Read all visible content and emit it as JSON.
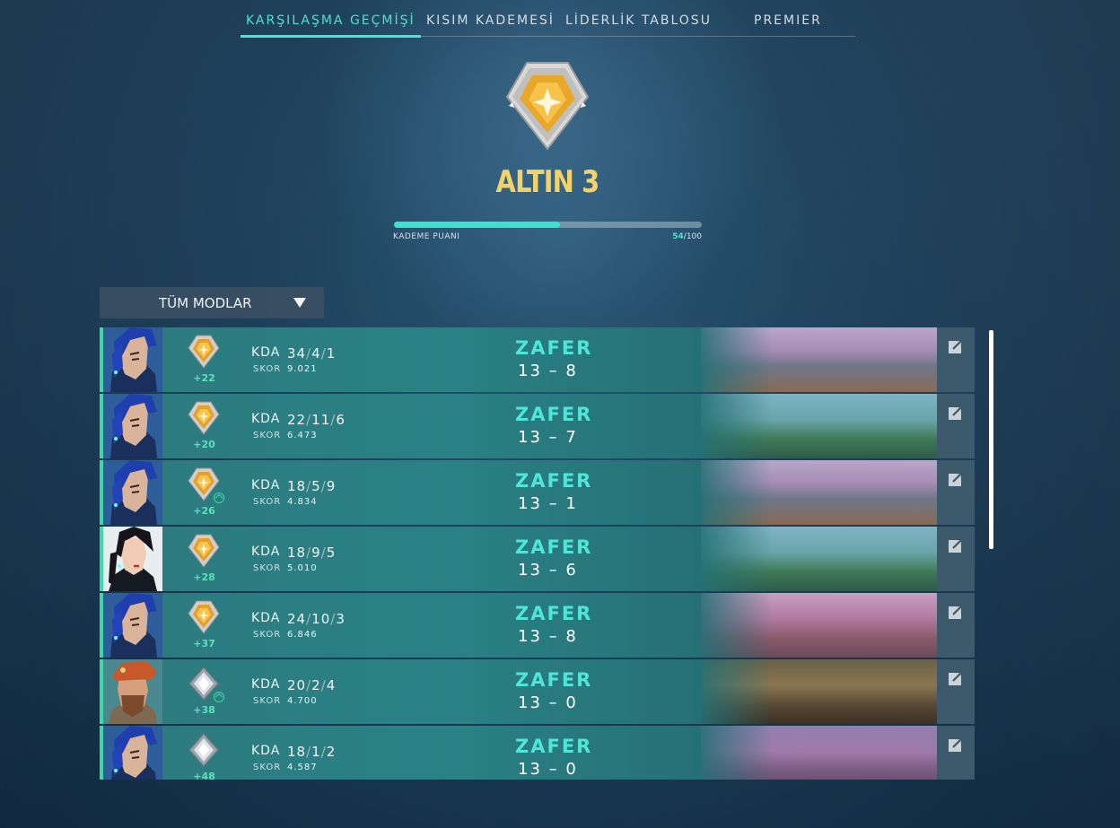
{
  "tabs": [
    {
      "label": "KARŞILAŞMA GEÇMİŞİ",
      "active": true
    },
    {
      "label": "KISIM KADEMESİ",
      "active": false
    },
    {
      "label": "LİDERLİK TABLOSU",
      "active": false
    },
    {
      "label": "PREMIER",
      "active": false
    }
  ],
  "rank": {
    "name": "ALTIN 3",
    "rr_label": "KADEME PUANI",
    "rr_current": "54",
    "rr_max": "/100",
    "rr_progress": 0.54
  },
  "mode_filter": {
    "label": "TÜM MODLAR"
  },
  "colors": {
    "accent": "#4fe0d0",
    "win": "#41d7a6",
    "gold": "#f3d26b"
  },
  "matches": [
    {
      "agent": "blue-hair-agent",
      "rank_icon": "gold-rank-icon",
      "rr_change": "+22",
      "kda_label": "KDA",
      "kills": "34",
      "deaths": "4",
      "assists": "1",
      "score_label": "SKOR",
      "score": "9.021",
      "result": "ZAFER",
      "team_score": "13",
      "enemy_score": "8",
      "map": "city-map",
      "promotion": false
    },
    {
      "agent": "blue-hair-agent",
      "rank_icon": "gold-rank-icon",
      "rr_change": "+20",
      "kda_label": "KDA",
      "kills": "22",
      "deaths": "11",
      "assists": "6",
      "score_label": "SKOR",
      "score": "6.473",
      "result": "ZAFER",
      "team_score": "13",
      "enemy_score": "7",
      "map": "temple-map",
      "promotion": false
    },
    {
      "agent": "blue-hair-agent",
      "rank_icon": "gold-rank-icon",
      "rr_change": "+26",
      "kda_label": "KDA",
      "kills": "18",
      "deaths": "5",
      "assists": "9",
      "score_label": "SKOR",
      "score": "4.834",
      "result": "ZAFER",
      "team_score": "13",
      "enemy_score": "1",
      "map": "city-map",
      "promotion": true
    },
    {
      "agent": "dark-hair-agent",
      "rank_icon": "gold-rank-icon",
      "rr_change": "+28",
      "kda_label": "KDA",
      "kills": "18",
      "deaths": "9",
      "assists": "5",
      "score_label": "SKOR",
      "score": "5.010",
      "result": "ZAFER",
      "team_score": "13",
      "enemy_score": "6",
      "map": "temple-map",
      "promotion": false
    },
    {
      "agent": "blue-hair-agent",
      "rank_icon": "gold-rank-icon",
      "rr_change": "+37",
      "kda_label": "KDA",
      "kills": "24",
      "deaths": "10",
      "assists": "3",
      "score_label": "SKOR",
      "score": "6.846",
      "result": "ZAFER",
      "team_score": "13",
      "enemy_score": "8",
      "map": "pink-map",
      "promotion": false
    },
    {
      "agent": "beret-agent",
      "rank_icon": "silver-rank-icon",
      "rr_change": "+38",
      "kda_label": "KDA",
      "kills": "20",
      "deaths": "2",
      "assists": "4",
      "score_label": "SKOR",
      "score": "4.700",
      "result": "ZAFER",
      "team_score": "13",
      "enemy_score": "0",
      "map": "desert-map",
      "promotion": true
    },
    {
      "agent": "blue-hair-agent",
      "rank_icon": "silver-rank-icon",
      "rr_change": "+48",
      "kda_label": "KDA",
      "kills": "18",
      "deaths": "1",
      "assists": "2",
      "score_label": "SKOR",
      "score": "4.587",
      "result": "ZAFER",
      "team_score": "13",
      "enemy_score": "0",
      "map": "purple-map",
      "promotion": false
    }
  ]
}
